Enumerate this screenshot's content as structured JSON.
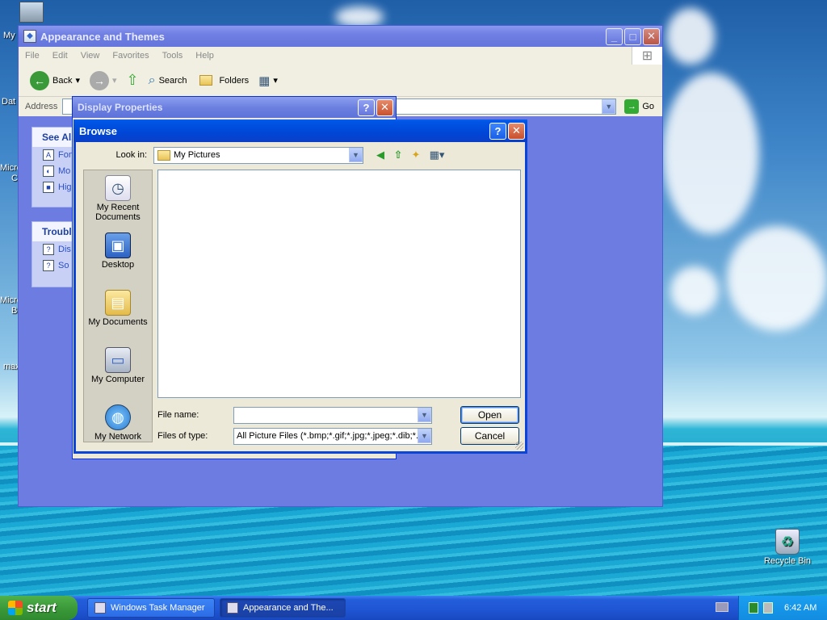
{
  "desktop": {
    "left_icon_labels": [
      "My",
      "Dat",
      "Micro",
      "C",
      "Micro",
      "B",
      "max"
    ],
    "recycle_bin": "Recycle Bin"
  },
  "explorer": {
    "title": "Appearance and Themes",
    "menu": [
      "File",
      "Edit",
      "View",
      "Favorites",
      "Tools",
      "Help"
    ],
    "toolbar": {
      "back": "Back",
      "search": "Search",
      "folders": "Folders"
    },
    "address_label": "Address",
    "go": "Go",
    "see_also": {
      "heading": "See Als",
      "items": [
        "Fon",
        "Mo",
        "Hig"
      ]
    },
    "troubleshooters": {
      "heading": "Troubl",
      "items": [
        "Dis",
        "So"
      ]
    }
  },
  "display_properties": {
    "title": "Display Properties"
  },
  "browse": {
    "title": "Browse",
    "look_in_label": "Look in:",
    "look_in_value": "My Pictures",
    "places": [
      {
        "label": "My Recent Documents",
        "icon": "recent-documents-icon"
      },
      {
        "label": "Desktop",
        "icon": "desktop-icon"
      },
      {
        "label": "My Documents",
        "icon": "my-documents-icon"
      },
      {
        "label": "My Computer",
        "icon": "my-computer-icon"
      },
      {
        "label": "My Network",
        "icon": "my-network-icon"
      }
    ],
    "file_name_label": "File name:",
    "file_name_value": "",
    "files_of_type_label": "Files of type:",
    "files_of_type_value": "All Picture Files (*.bmp;*.gif;*.jpg;*.jpeg;*.dib;*.pr",
    "open": "Open",
    "cancel": "Cancel"
  },
  "taskbar": {
    "start": "start",
    "tasks": [
      "Windows Task Manager",
      "Appearance and The..."
    ],
    "clock": "6:42 AM"
  }
}
